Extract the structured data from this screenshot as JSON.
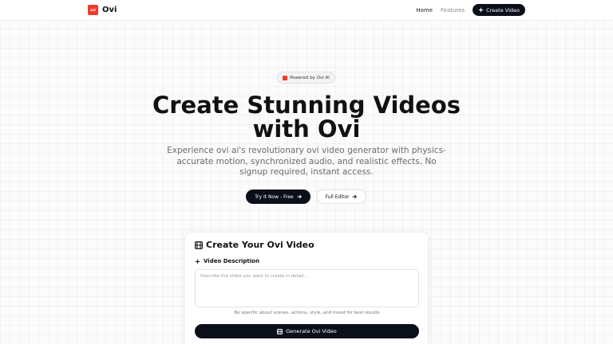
{
  "nav": {
    "logo_mark": "ovi",
    "logo_text": "Ovi",
    "links": [
      "Home",
      "Features"
    ],
    "cta_label": "Create Video"
  },
  "hero": {
    "badge": "Powered by Ovi AI",
    "title": "Create Stunning Videos with Ovi",
    "subtitle": "Experience ovi ai's revolutionary ovi video generator with physics-accurate motion, synchronized audio, and realistic effects. No signup required, instant access.",
    "primary_button": "Try It Now - Free",
    "secondary_button": "Full Editor"
  },
  "card": {
    "title": "Create Your Ovi Video",
    "field_label": "Video Description",
    "placeholder": "Describe the video you want to create in detail...",
    "hint": "Be specific about scenes, actions, style, and mood for best results",
    "generate_button": "Generate Ovi Video"
  },
  "icons": {
    "nav_cta": "sparkle-icon",
    "badge": "ovi-logo-icon",
    "primary_arrow": "arrow-right-icon",
    "secondary_arrow": "arrow-right-icon",
    "card_title": "film-icon",
    "field_label": "sparkle-icon",
    "generate": "film-icon"
  },
  "colors": {
    "brand": "#ef3b2c",
    "dark": "#0b0f1a",
    "muted_text": "#6b6b6b"
  }
}
